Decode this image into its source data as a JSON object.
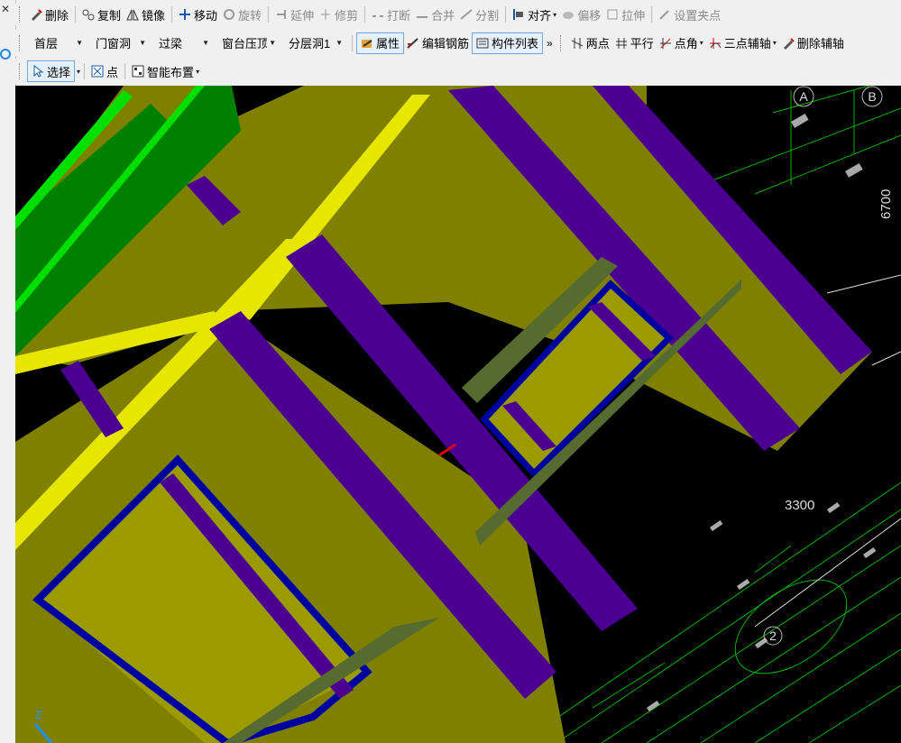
{
  "toolbar1": {
    "items": [
      {
        "label": "删除",
        "icon": "delete-icon",
        "enabled": true
      },
      {
        "label": "复制",
        "icon": "copy-icon",
        "enabled": true
      },
      {
        "label": "镜像",
        "icon": "mirror-icon",
        "enabled": true
      },
      {
        "label": "移动",
        "icon": "move-icon",
        "enabled": true
      },
      {
        "label": "旋转",
        "icon": "rotate-icon",
        "enabled": false
      },
      {
        "label": "延伸",
        "icon": "extend-icon",
        "enabled": false
      },
      {
        "label": "修剪",
        "icon": "trim-icon",
        "enabled": false
      },
      {
        "label": "打断",
        "icon": "break-icon",
        "enabled": false
      },
      {
        "label": "合并",
        "icon": "merge-icon",
        "enabled": false
      },
      {
        "label": "分割",
        "icon": "split-icon",
        "enabled": false
      },
      {
        "label": "对齐",
        "icon": "align-icon",
        "enabled": true
      },
      {
        "label": "偏移",
        "icon": "offset-icon",
        "enabled": false
      },
      {
        "label": "拉伸",
        "icon": "stretch-icon",
        "enabled": false
      },
      {
        "label": "设置夹点",
        "icon": "grip-point-icon",
        "enabled": false
      }
    ]
  },
  "toolbar2": {
    "floor": "首层",
    "category": "门窗洞",
    "type": "过梁",
    "component": "窗台压顶",
    "layer": "分层洞1",
    "properties_label": "属性",
    "edit_rebar_label": "编辑钢筋",
    "component_list_label": "构件列表",
    "overflow": "»",
    "two_points_label": "两点",
    "parallel_label": "平行",
    "point_angle_label": "点角",
    "three_point_axis_label": "三点辅轴",
    "delete_axis_label": "删除辅轴"
  },
  "toolbar3": {
    "select_label": "选择",
    "point_label": "点",
    "smart_layout_label": "智能布置"
  },
  "viewport": {
    "axis_a": "A",
    "axis_b": "B",
    "axis_2": "2",
    "dim_6700": "6700",
    "dim_3300": "3300",
    "z_label": "Z",
    "colors": {
      "background": "#000000",
      "wall": "#7f7f00",
      "wall_light": "#9b9b00",
      "lintel_yellow": "#e6e600",
      "beam_purple": "#4b0092",
      "frame_blue": "#0000a0",
      "green": "#008000",
      "green_bright": "#00e000",
      "grid_green": "#00c000"
    }
  }
}
